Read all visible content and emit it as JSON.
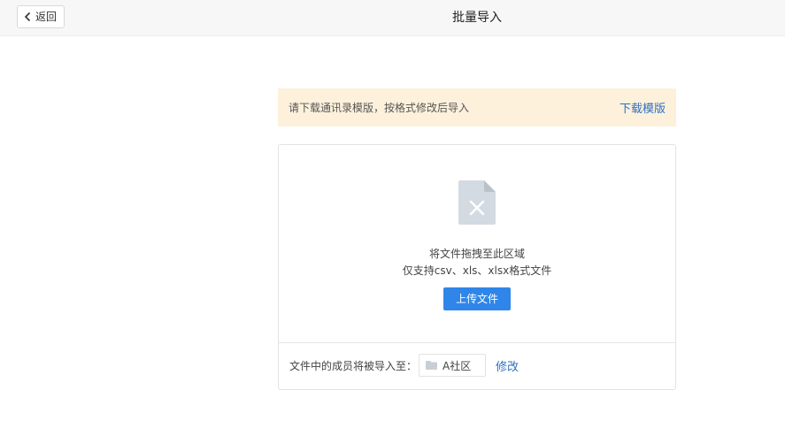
{
  "header": {
    "back_label": "返回",
    "title": "批量导入"
  },
  "notice": {
    "message": "请下载通讯录模版，按格式修改后导入",
    "download_link": "下载模版",
    "background": "#fdf1dc"
  },
  "upload": {
    "drop_hint": "将文件拖拽至此区域",
    "format_hint": "仅支持csv、xls、xlsx格式文件",
    "button_label": "上传文件",
    "button_color": "#2f86e8",
    "icon": "excel-file-icon"
  },
  "destination": {
    "label": "文件中的成员将被导入至：",
    "folder_icon": "folder-icon",
    "target_name": "A社区",
    "modify_link": "修改",
    "link_color": "#2f6fc2"
  }
}
